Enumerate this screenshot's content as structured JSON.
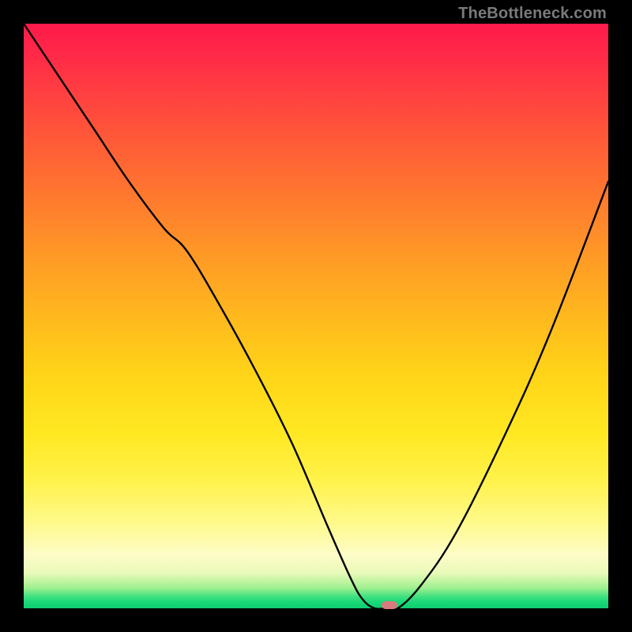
{
  "watermark": "TheBottleneck.com",
  "chart_data": {
    "type": "line",
    "title": "",
    "xlabel": "",
    "ylabel": "",
    "xlim": [
      0,
      100
    ],
    "ylim": [
      0,
      100
    ],
    "grid": false,
    "background_gradient": {
      "top": "#ff1a4a",
      "mid": "#ffd418",
      "bottom": "#10cc70"
    },
    "series": [
      {
        "name": "bottleneck-curve",
        "x": [
          0,
          6,
          12,
          18,
          24,
          28,
          34,
          40,
          46,
          52,
          56,
          58,
          60,
          62,
          64,
          68,
          74,
          82,
          90,
          100
        ],
        "y": [
          100,
          91,
          82,
          73,
          65,
          61,
          51,
          40,
          28,
          14,
          5,
          1.5,
          0,
          0,
          0,
          4,
          13,
          29,
          47,
          73
        ]
      }
    ],
    "marker": {
      "x": 62.5,
      "y": 0.5,
      "color": "#d97a7e"
    }
  }
}
